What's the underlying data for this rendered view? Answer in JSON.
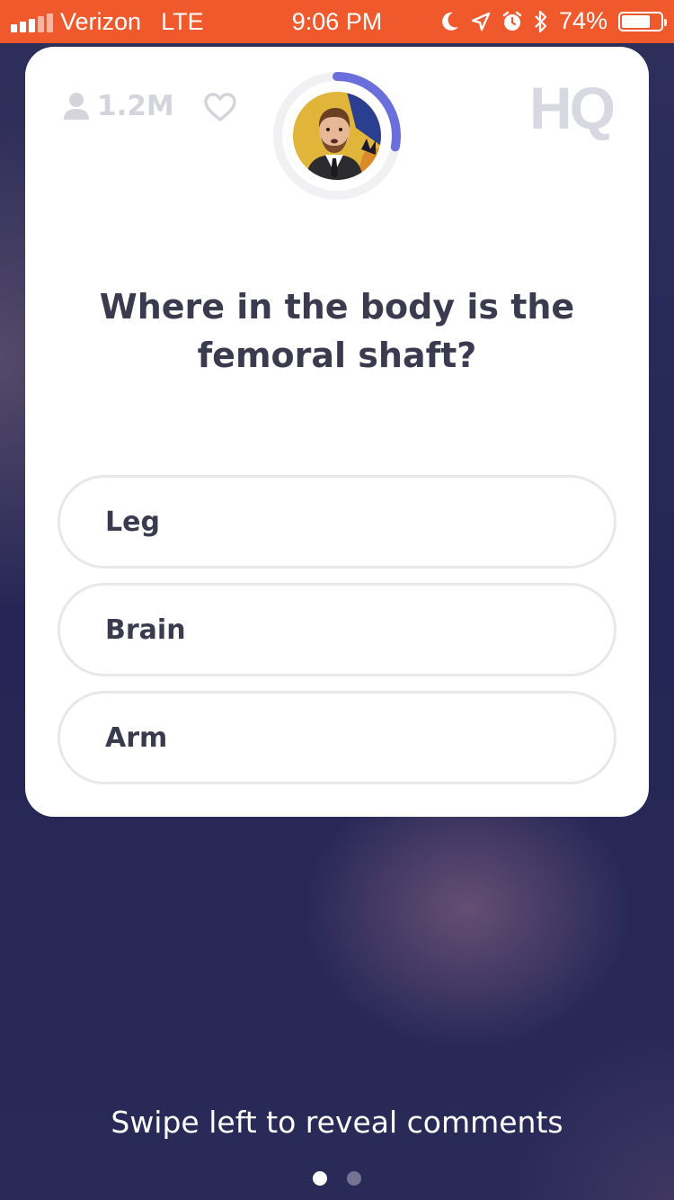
{
  "status_bar": {
    "carrier": "Verizon",
    "network": "LTE",
    "time": "9:06 PM",
    "battery": "74%",
    "battery_level": 0.74,
    "color": "#f0592b"
  },
  "header": {
    "viewer_count": "1.2M",
    "logo": "HQ",
    "timer_progress": 0.28
  },
  "question": {
    "text": "Where in the body is the femoral shaft?"
  },
  "answers": [
    {
      "label": "Leg"
    },
    {
      "label": "Brain"
    },
    {
      "label": "Arm"
    }
  ],
  "footer": {
    "hint": "Swipe left to reveal comments",
    "pages": 2,
    "active_page": 1
  },
  "colors": {
    "accent_timer": "#6b6fdc",
    "text_dark": "#3b3b4f",
    "muted": "#d4d4dc"
  }
}
